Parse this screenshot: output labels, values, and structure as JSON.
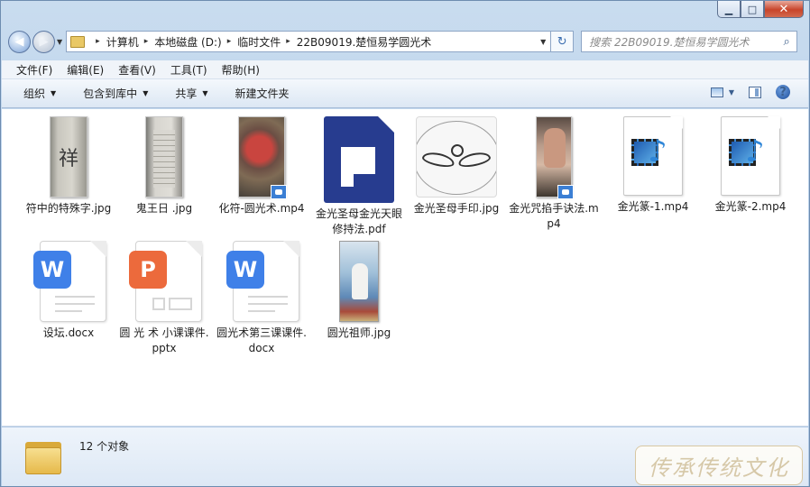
{
  "window": {
    "caption_buttons": {
      "minimize": "▁",
      "maximize": "□",
      "close": "✕"
    }
  },
  "nav": {
    "back_glyph": "◀",
    "forward_glyph": "▶",
    "history_glyph": "▼"
  },
  "address": {
    "crumbs": [
      "计算机",
      "本地磁盘 (D:)",
      "临时文件",
      "22B09019.楚恒易学圆光术"
    ],
    "separator": "▸",
    "dropdown": "▼",
    "refresh_glyph": "↻"
  },
  "search": {
    "placeholder": "搜索 22B09019.楚恒易学圆光术",
    "icon": "⌕"
  },
  "menu": [
    "文件(F)",
    "编辑(E)",
    "查看(V)",
    "工具(T)",
    "帮助(H)"
  ],
  "commands": [
    {
      "label": "组织",
      "has_arrow": true
    },
    {
      "label": "包含到库中",
      "has_arrow": true
    },
    {
      "label": "共享",
      "has_arrow": true
    },
    {
      "label": "新建文件夹",
      "has_arrow": false
    }
  ],
  "command_arrow": "▼",
  "help_glyph": "?",
  "files": [
    {
      "name": "符中的特殊字.jpg",
      "kind": "jpg-paper-glyph",
      "glyph": "祥"
    },
    {
      "name": "鬼王日 .jpg",
      "kind": "jpg-paper-list"
    },
    {
      "name": "化符-圆光术.mp4",
      "kind": "mp4-thumb-1"
    },
    {
      "name": "金光圣母金光天眼修持法.pdf",
      "kind": "pdf"
    },
    {
      "name": "金光圣母手印.jpg",
      "kind": "jpg-mudra"
    },
    {
      "name": "金光咒掐手诀法.mp4",
      "kind": "mp4-thumb-2"
    },
    {
      "name": "金光篆-1.mp4",
      "kind": "media-generic"
    },
    {
      "name": "金光篆-2.mp4",
      "kind": "media-generic"
    },
    {
      "name": "设坛.docx",
      "kind": "docx",
      "badge": "W"
    },
    {
      "name": "圆 光 术 小课课件.pptx",
      "kind": "pptx",
      "badge": "P"
    },
    {
      "name": "圆光术第三课课件.docx",
      "kind": "docx",
      "badge": "W"
    },
    {
      "name": "圆光祖师.jpg",
      "kind": "jpg-poster"
    }
  ],
  "status": {
    "count": "12 个对象"
  },
  "watermark": "传承传统文化",
  "colors": {
    "pdf": "#273c8f",
    "docx_badge": "#3f80e8",
    "pptx_badge": "#ec6a3c",
    "close_button": "#c8442a"
  }
}
